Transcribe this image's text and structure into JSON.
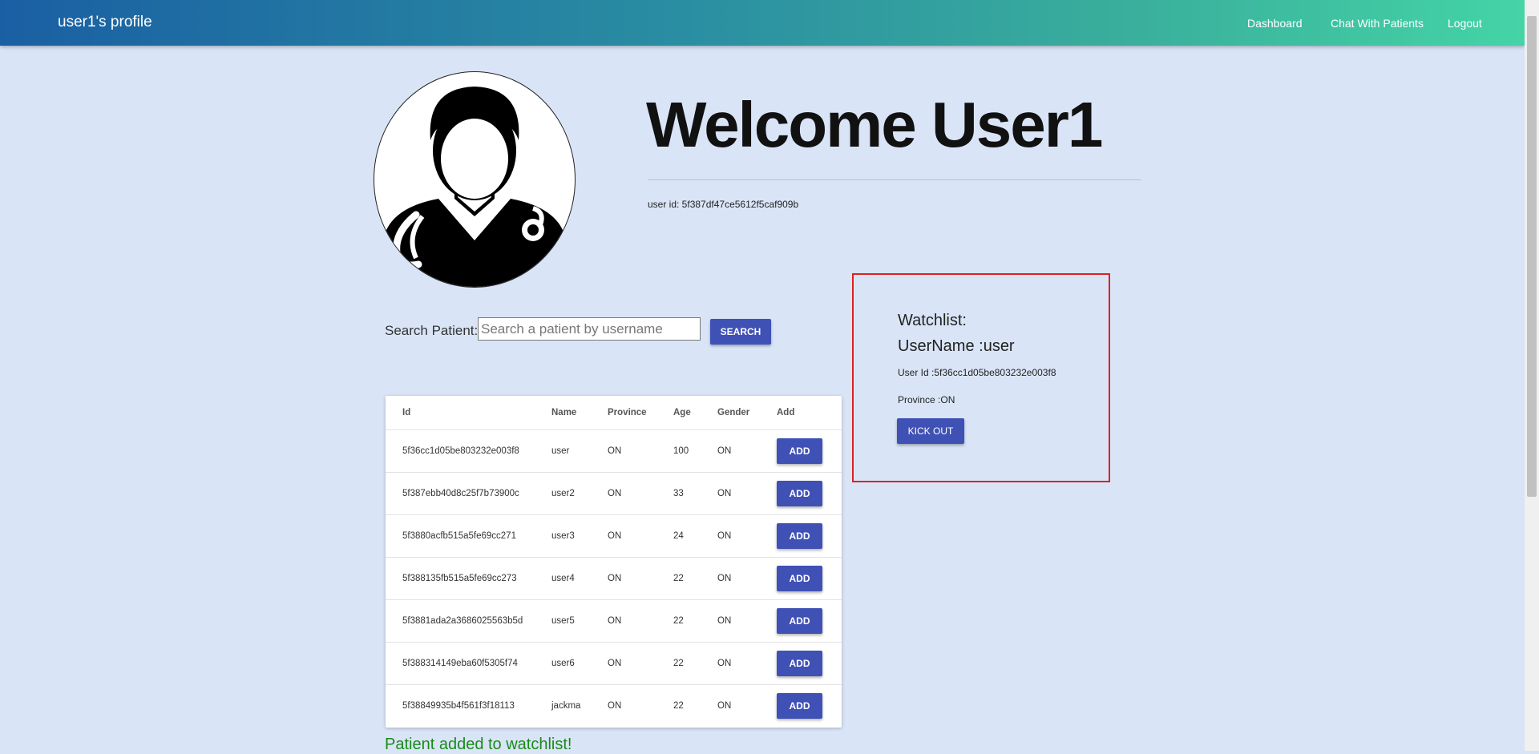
{
  "nav": {
    "brand": "user1's profile",
    "links": [
      "Dashboard",
      "Chat With Patients",
      "Logout"
    ]
  },
  "profile": {
    "welcome": "Welcome User1",
    "user_id": "user id: 5f387df47ce5612f5caf909b",
    "avatar_icon": "doctor-avatar-icon"
  },
  "search": {
    "label": "Search Patient:",
    "placeholder": "Search a patient by username",
    "button": "SEARCH"
  },
  "table": {
    "headers": [
      "Id",
      "Name",
      "Province",
      "Age",
      "Gender",
      "Add"
    ],
    "add_label": "ADD",
    "rows": [
      {
        "id": "5f36cc1d05be803232e003f8",
        "name": "user",
        "province": "ON",
        "age": "100",
        "gender": "ON"
      },
      {
        "id": "5f387ebb40d8c25f7b73900c",
        "name": "user2",
        "province": "ON",
        "age": "33",
        "gender": "ON"
      },
      {
        "id": "5f3880acfb515a5fe69cc271",
        "name": "user3",
        "province": "ON",
        "age": "24",
        "gender": "ON"
      },
      {
        "id": "5f388135fb515a5fe69cc273",
        "name": "user4",
        "province": "ON",
        "age": "22",
        "gender": "ON"
      },
      {
        "id": "5f3881ada2a3686025563b5d",
        "name": "user5",
        "province": "ON",
        "age": "22",
        "gender": "ON"
      },
      {
        "id": "5f388314149eba60f5305f74",
        "name": "user6",
        "province": "ON",
        "age": "22",
        "gender": "ON"
      },
      {
        "id": "5f38849935b4f561f3f18113",
        "name": "jackma",
        "province": "ON",
        "age": "22",
        "gender": "ON"
      }
    ]
  },
  "message": "Patient added to watchlist!",
  "watchlist": {
    "title": "Watchlist:",
    "username": "UserName :user",
    "user_id": "User Id :5f36cc1d05be803232e003f8",
    "province": "Province :ON",
    "button": "KICK OUT"
  },
  "colors": {
    "nav_gradient_start": "#1a5fa3",
    "nav_gradient_end": "#44d4a6",
    "background": "#d9e5f7",
    "button": "#3f51b5",
    "highlight_border": "#e02020",
    "success_text": "#1a8a1a"
  }
}
